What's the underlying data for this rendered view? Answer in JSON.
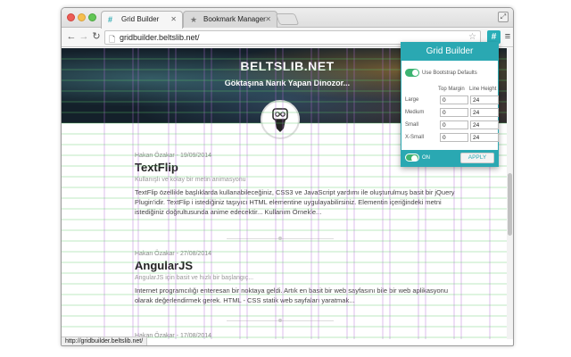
{
  "tabs": [
    {
      "label": "Grid Builder",
      "icon": "hash-icon"
    },
    {
      "label": "Bookmark Manager",
      "icon": "star-icon"
    }
  ],
  "toolbar": {
    "url": "gridbuilder.beltslib.net/"
  },
  "site": {
    "title": "BELTSLIB.NET",
    "subtitle": "Göktaşına Narık Yapan Dinozor..."
  },
  "posts": [
    {
      "meta": "Hakan Özakar - 19/09/2014",
      "title": "TextFlip",
      "subtitle": "Kullanışlı ve kolay bir metin animasyonu",
      "body": "TextFlip özellikle başlıklarda kullanabileceğiniz, CSS3 ve JavaScript yardımı ile oluşturulmuş basit bir jQuery Plugin'idir. TextFlip i istediğiniz taşıyıcı HTML elementine uygulayabilirsiniz. Elementin içeriğindeki metni istediğiniz doğrultusunda animе edecektir... Kullanım Örnekle..."
    },
    {
      "meta": "Hakan Özakar - 27/08/2014",
      "title": "AngularJS",
      "subtitle": "AngularJS için basit ve hızlı bir başlangıç...",
      "body": "Internet programcılığı enteresan bir noktaya geldi. Artık en basit bir web sayfasını bile bir web aplikasyonu olarak değerlendirmek gerek. HTML - CSS statik web sayfaları yaratmak..."
    },
    {
      "meta": "Hakan Özakar - 17/08/2014"
    }
  ],
  "statusbar": "http://gridbuilder.beltslib.net/",
  "popup": {
    "title": "Grid Builder",
    "bootstrap_label": "Use Bootstrap Defaults",
    "col_top_margin": "Top Margin",
    "col_line_height": "Line Height",
    "rows": [
      {
        "label": "Large",
        "top_margin": "0",
        "line_height": "24"
      },
      {
        "label": "Medium",
        "top_margin": "0",
        "line_height": "24"
      },
      {
        "label": "Small",
        "top_margin": "0",
        "line_height": "24"
      },
      {
        "label": "X-Small",
        "top_margin": "0",
        "line_height": "24"
      }
    ],
    "toggle_label": "ON",
    "apply_label": "APPLY"
  },
  "colors": {
    "accent": "#2aa8b2",
    "switch_on": "#3cb371",
    "grid_vertical": "#b36bd6",
    "grid_horizontal": "#5cc96a"
  }
}
